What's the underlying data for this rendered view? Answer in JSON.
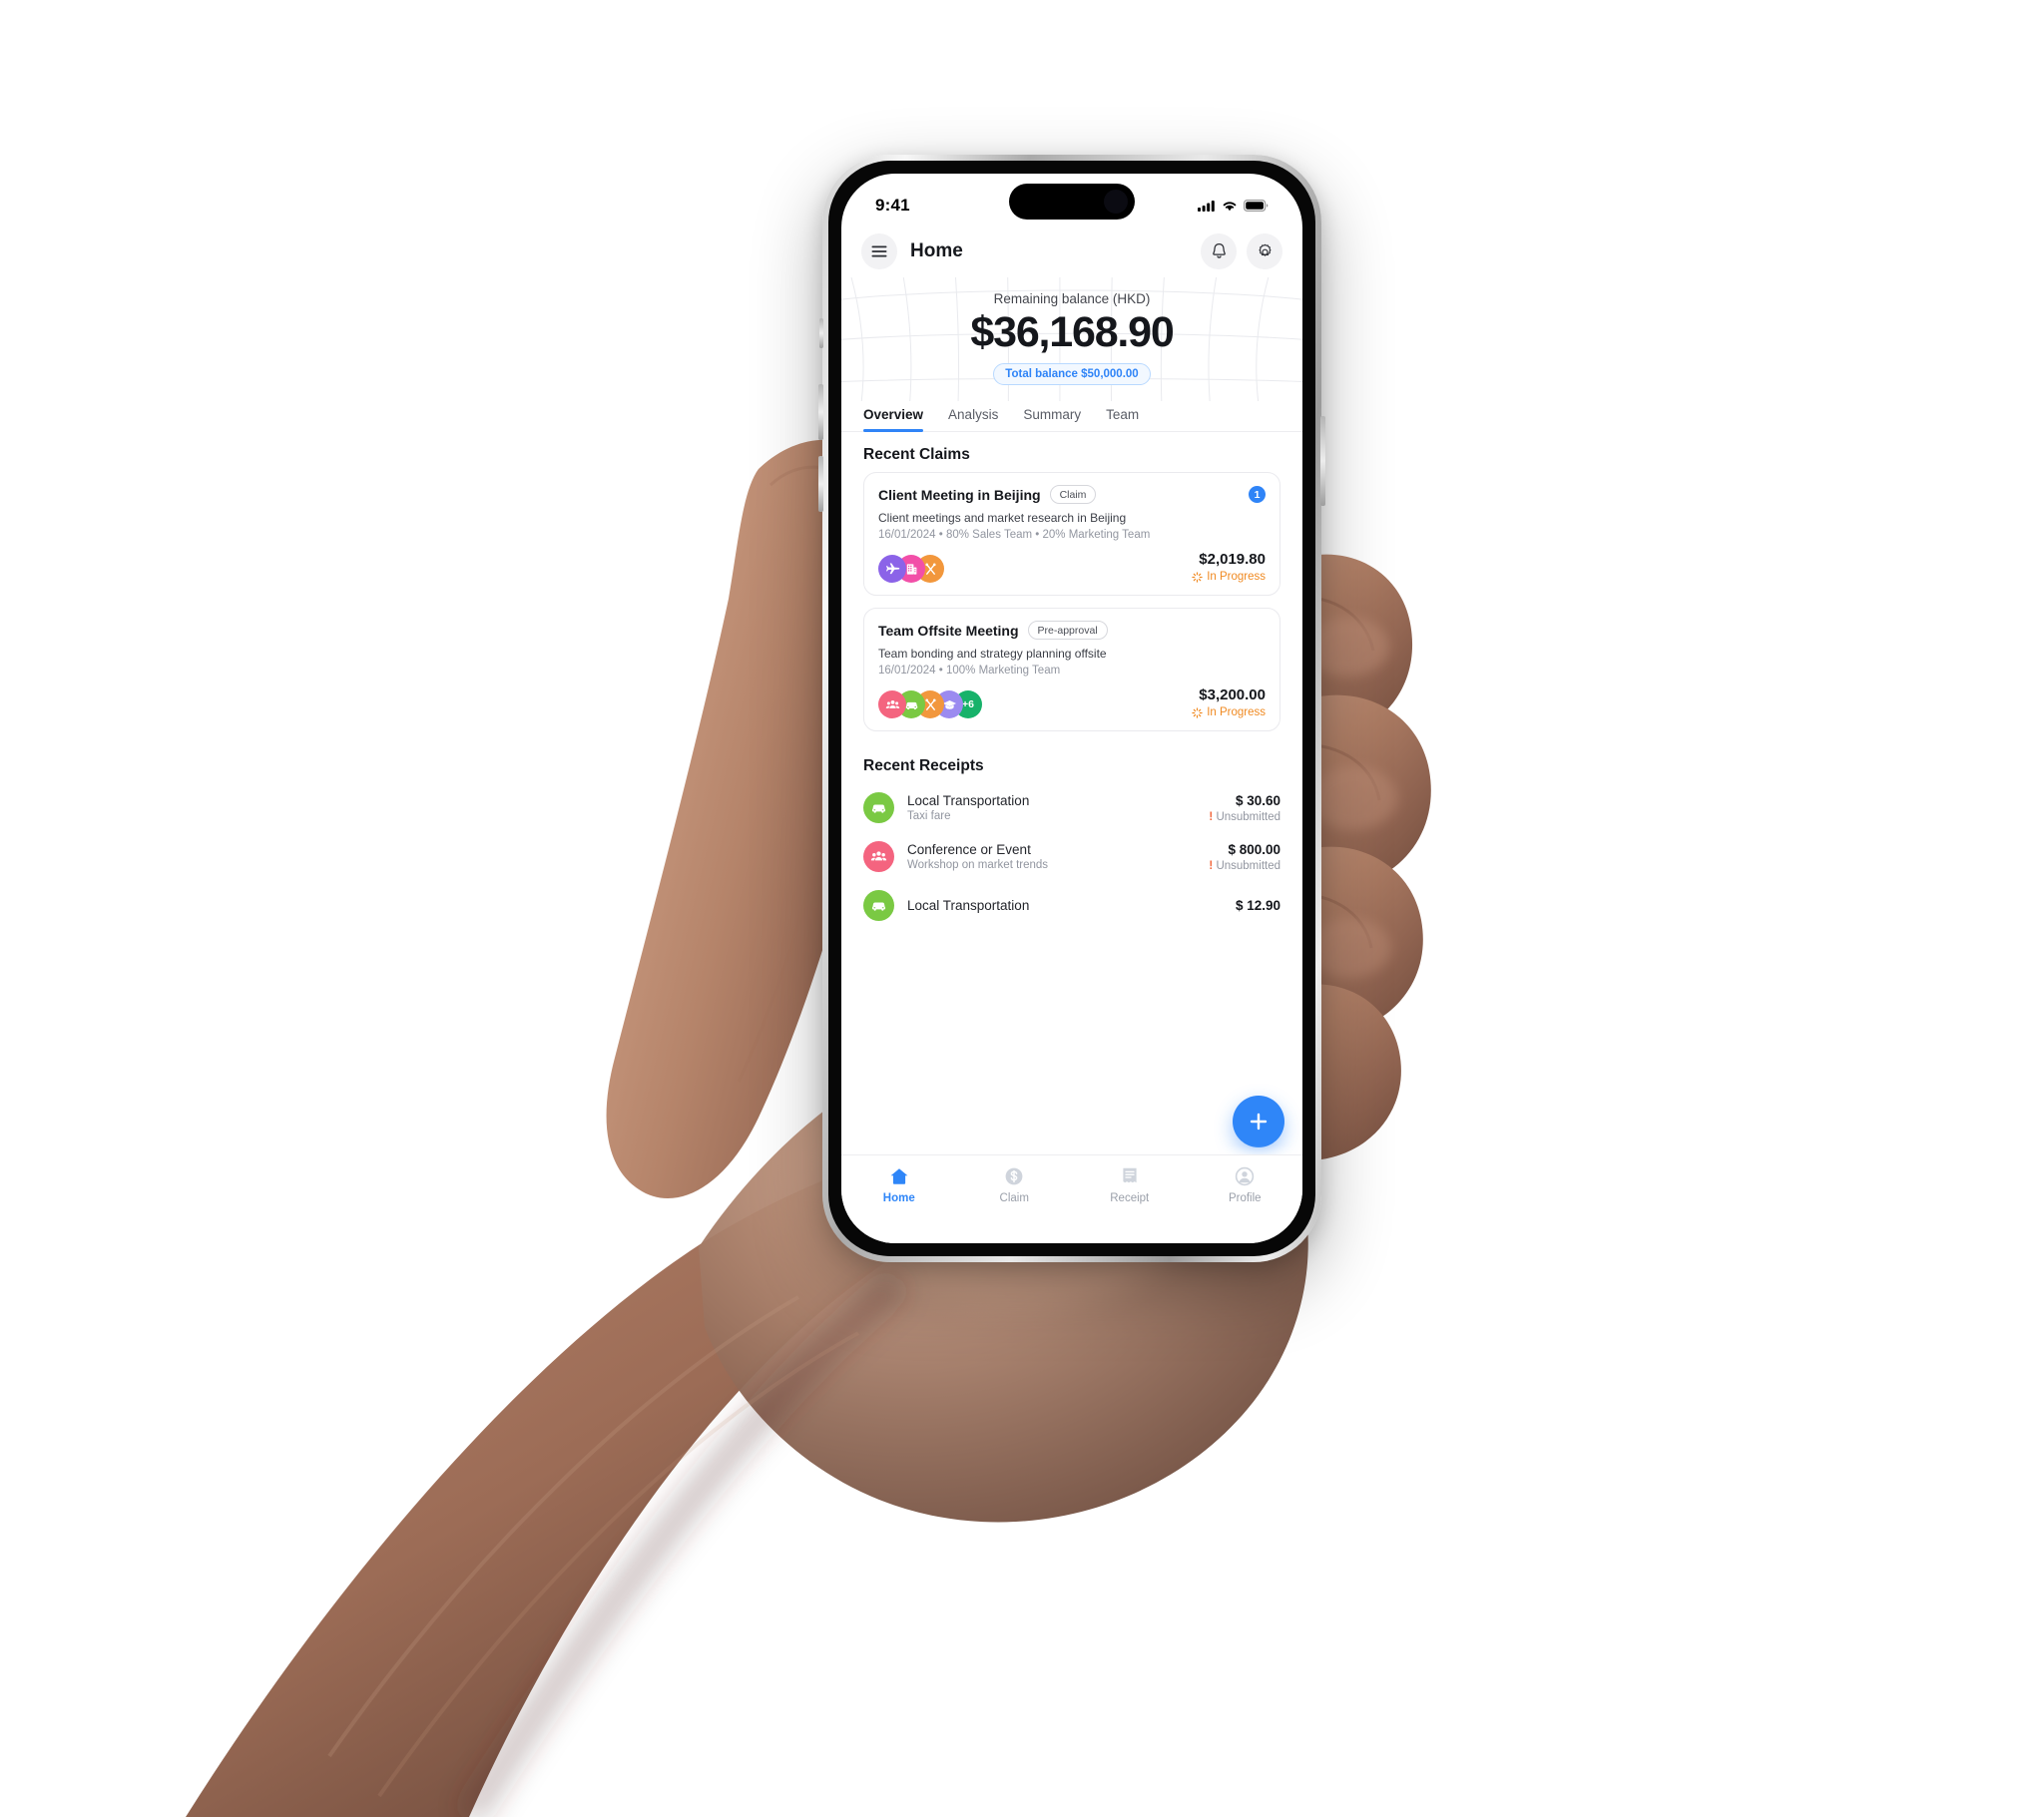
{
  "status_bar": {
    "time": "9:41",
    "icons": [
      "cellular-signal-icon",
      "wifi-icon",
      "battery-icon"
    ]
  },
  "header": {
    "menu_icon": "hamburger-menu-icon",
    "title": "Home",
    "notification_icon": "bell-icon",
    "settings_icon": "gear-icon"
  },
  "balance": {
    "label": "Remaining balance (HKD)",
    "amount": "$36,168.90",
    "total_pill": "Total balance $50,000.00",
    "accent_color": "#2f84f7"
  },
  "tabs": [
    {
      "label": "Overview",
      "active": true
    },
    {
      "label": "Analysis",
      "active": false
    },
    {
      "label": "Summary",
      "active": false
    },
    {
      "label": "Team",
      "active": false
    }
  ],
  "sections": {
    "recent_claims_title": "Recent Claims",
    "recent_receipts_title": "Recent Receipts"
  },
  "claims": [
    {
      "title": "Client Meeting in Beijing",
      "chip": "Claim",
      "badge": "1",
      "description": "Client meetings and market research in Beijing",
      "meta": "16/01/2024  •  80% Sales Team  •  20% Marketing Team",
      "amount": "$2,019.80",
      "status": "In Progress",
      "status_color": "#f08a22",
      "avatars": [
        {
          "icon": "airplane-icon",
          "color": "#8b63e8",
          "label": ""
        },
        {
          "icon": "hotel-building-icon",
          "color": "#f24fa8",
          "label": ""
        },
        {
          "icon": "meal-utensils-icon",
          "color": "#f2973c",
          "label": ""
        }
      ]
    },
    {
      "title": "Team Offsite Meeting",
      "chip": "Pre-approval",
      "badge": "",
      "description": "Team bonding and strategy planning offsite",
      "meta": "16/01/2024  •  100% Marketing Team",
      "amount": "$3,200.00",
      "status": "In Progress",
      "status_color": "#f08a22",
      "avatars": [
        {
          "icon": "people-group-icon",
          "color": "#f4647f",
          "label": ""
        },
        {
          "icon": "car-icon",
          "color": "#7ac943",
          "label": ""
        },
        {
          "icon": "meal-utensils-icon",
          "color": "#f2973c",
          "label": ""
        },
        {
          "icon": "graduation-cap-icon",
          "color": "#9b8bf0",
          "label": ""
        },
        {
          "icon": "overflow-count",
          "color": "#17b26a",
          "label": "+6"
        }
      ]
    }
  ],
  "receipts": [
    {
      "icon": "car-icon",
      "icon_color": "#7ac943",
      "title": "Local Transportation",
      "subtitle": "Taxi fare",
      "amount": "$ 30.60",
      "state": "Unsubmitted",
      "state_marker": "!"
    },
    {
      "icon": "people-group-icon",
      "icon_color": "#f4647f",
      "title": "Conference or Event",
      "subtitle": "Workshop on market trends",
      "amount": "$ 800.00",
      "state": "Unsubmitted",
      "state_marker": "!"
    },
    {
      "icon": "car-icon",
      "icon_color": "#7ac943",
      "title": "Local Transportation",
      "subtitle": "",
      "amount": "$ 12.90",
      "state": "",
      "state_marker": ""
    }
  ],
  "fab": {
    "icon": "plus-icon",
    "color": "#2f86f8"
  },
  "bottom_nav": [
    {
      "label": "Home",
      "icon": "home-icon",
      "active": true
    },
    {
      "label": "Claim",
      "icon": "dollar-circle-icon",
      "active": false
    },
    {
      "label": "Receipt",
      "icon": "receipt-icon",
      "active": false
    },
    {
      "label": "Profile",
      "icon": "person-circle-icon",
      "active": false
    }
  ]
}
